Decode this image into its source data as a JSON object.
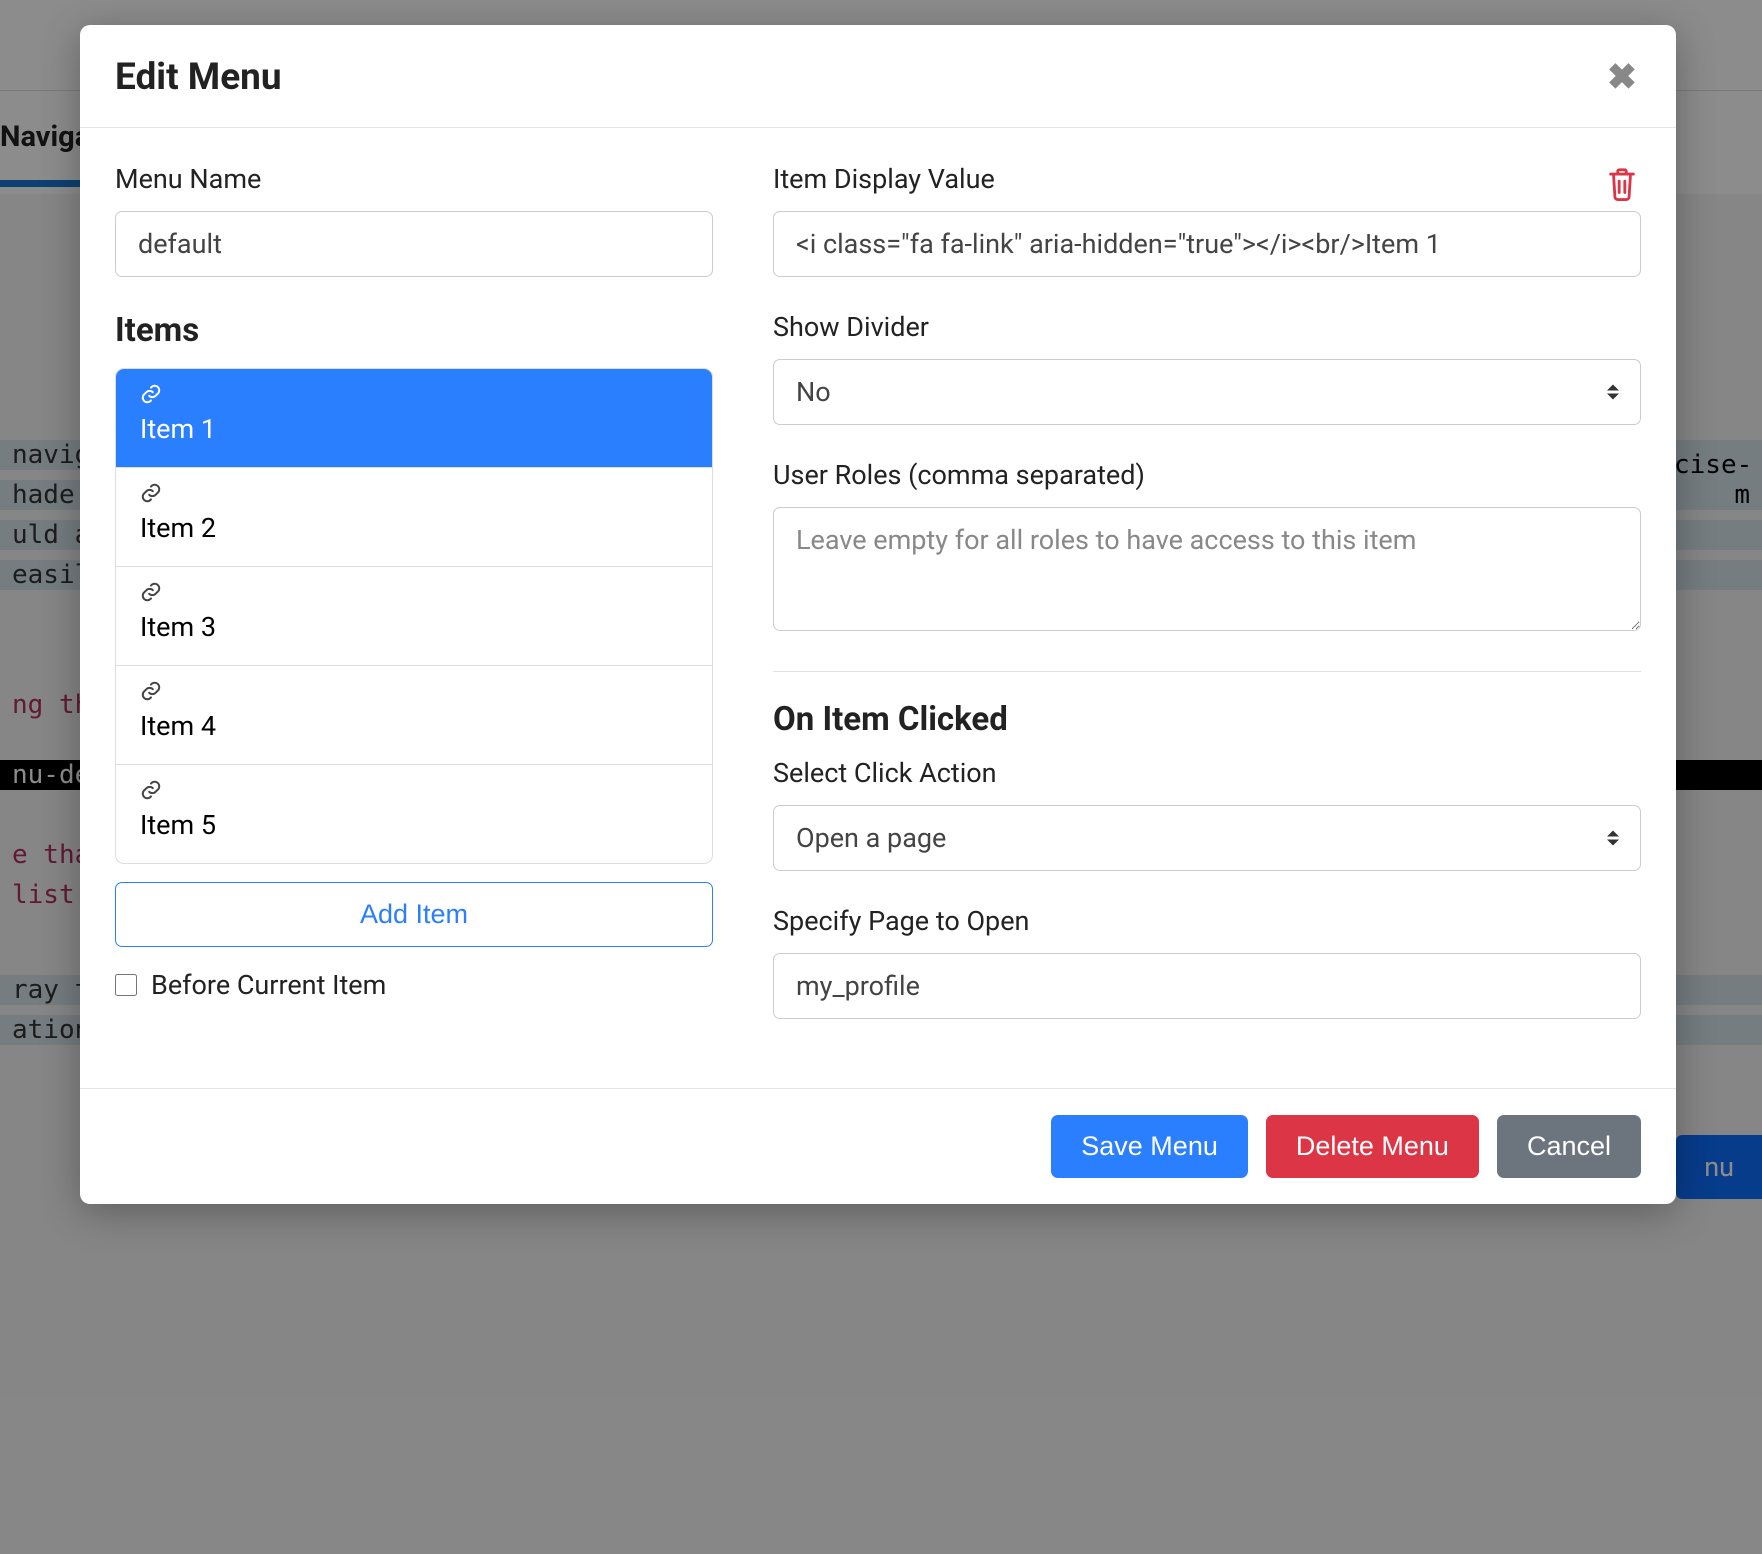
{
  "background": {
    "tab_label": "Naviga",
    "text_fragments": [
      "naviga",
      "hade u",
      "uld al",
      "easily",
      "ng th",
      "nu-de",
      "e tha",
      "list.",
      "ray to",
      "ation"
    ],
    "right_text": "cise-m",
    "button_fragment": "nu"
  },
  "modal": {
    "title": "Edit Menu",
    "left": {
      "menu_name_label": "Menu Name",
      "menu_name_value": "default",
      "items_title": "Items",
      "items": [
        {
          "label": "Item 1",
          "active": true
        },
        {
          "label": "Item 2",
          "active": false
        },
        {
          "label": "Item 3",
          "active": false
        },
        {
          "label": "Item 4",
          "active": false
        },
        {
          "label": "Item 5",
          "active": false
        }
      ],
      "add_item_label": "Add Item",
      "before_current_label": "Before Current Item",
      "before_current_checked": false
    },
    "right": {
      "display_value_label": "Item Display Value",
      "display_value_value": "<i class=\"fa fa-link\" aria-hidden=\"true\"></i><br/>Item 1",
      "show_divider_label": "Show Divider",
      "show_divider_value": "No",
      "user_roles_label": "User Roles (comma separated)",
      "user_roles_placeholder": "Leave empty for all roles to have access to this item",
      "user_roles_value": "",
      "on_click_title": "On Item Clicked",
      "click_action_label": "Select Click Action",
      "click_action_value": "Open a page",
      "page_label": "Specify Page to Open",
      "page_value": "my_profile"
    },
    "footer": {
      "save": "Save Menu",
      "delete": "Delete Menu",
      "cancel": "Cancel"
    }
  }
}
